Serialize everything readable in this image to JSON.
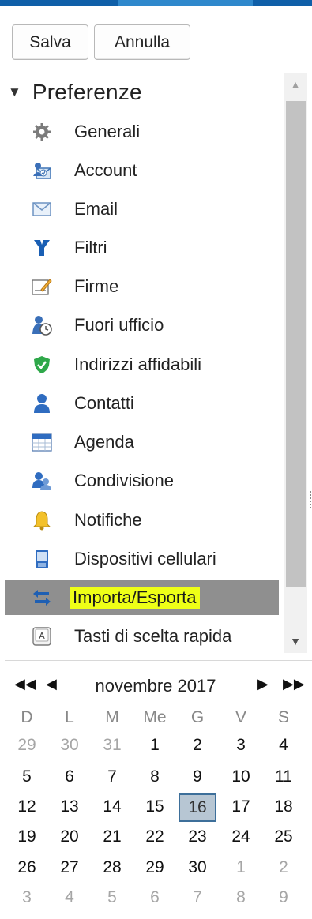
{
  "toolbar": {
    "save_label": "Salva",
    "cancel_label": "Annulla"
  },
  "tree": {
    "root_label": "Preferenze",
    "items": [
      {
        "label": "Generali",
        "icon": "gear-icon"
      },
      {
        "label": "Account",
        "icon": "account-icon"
      },
      {
        "label": "Email",
        "icon": "envelope-icon"
      },
      {
        "label": "Filtri",
        "icon": "filter-icon"
      },
      {
        "label": "Firme",
        "icon": "signature-icon"
      },
      {
        "label": "Fuori ufficio",
        "icon": "out-of-office-icon"
      },
      {
        "label": "Indirizzi affidabili",
        "icon": "shield-check-icon"
      },
      {
        "label": "Contatti",
        "icon": "contact-icon"
      },
      {
        "label": "Agenda",
        "icon": "calendar-icon"
      },
      {
        "label": "Condivisione",
        "icon": "sharing-icon"
      },
      {
        "label": "Notifiche",
        "icon": "bell-icon"
      },
      {
        "label": "Dispositivi cellulari",
        "icon": "mobile-device-icon"
      },
      {
        "label": "Importa/Esporta",
        "icon": "import-export-icon",
        "selected": true
      },
      {
        "label": "Tasti di scelta rapida",
        "icon": "keyboard-key-icon"
      }
    ]
  },
  "calendar": {
    "month_label": "novembre 2017",
    "weekday_headers": [
      "D",
      "L",
      "M",
      "Me",
      "G",
      "V",
      "S"
    ],
    "weeks": [
      [
        "29",
        "30",
        "31",
        "1",
        "2",
        "3",
        "4"
      ],
      [
        "5",
        "6",
        "7",
        "8",
        "9",
        "10",
        "11"
      ],
      [
        "12",
        "13",
        "14",
        "15",
        "16",
        "17",
        "18"
      ],
      [
        "19",
        "20",
        "21",
        "22",
        "23",
        "24",
        "25"
      ],
      [
        "26",
        "27",
        "28",
        "29",
        "30",
        "1",
        "2"
      ],
      [
        "3",
        "4",
        "5",
        "6",
        "7",
        "8",
        "9"
      ]
    ],
    "today": "16"
  },
  "colors": {
    "header_dark": "#0f5fa8",
    "header_light": "#2f88cc",
    "selected_row": "#8f8f8f",
    "highlight": "#eeff17",
    "today_fill": "#b7c6d3",
    "today_border": "#3d6f9a"
  }
}
